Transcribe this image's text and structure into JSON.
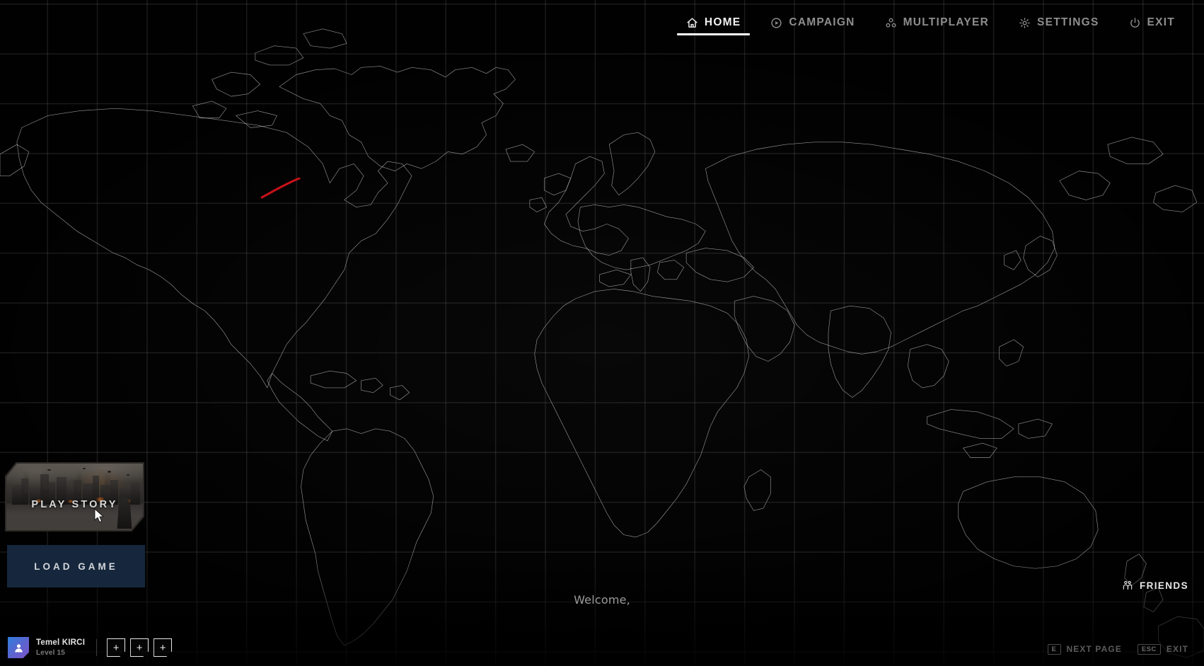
{
  "nav": {
    "items": [
      {
        "label": "HOME",
        "icon": "home-icon",
        "active": true
      },
      {
        "label": "CAMPAIGN",
        "icon": "play-circle-icon",
        "active": false
      },
      {
        "label": "MULTIPLAYER",
        "icon": "multiplayer-icon",
        "active": false
      },
      {
        "label": "SETTINGS",
        "icon": "gear-icon",
        "active": false
      },
      {
        "label": "EXIT",
        "icon": "power-icon",
        "active": false
      }
    ]
  },
  "left_panel": {
    "story_card": {
      "label": "PLAY STORY",
      "art": "destroyed-city"
    },
    "load_game": {
      "label": "LOAD GAME",
      "color": "#16273d"
    }
  },
  "profile": {
    "name": "Temel KIRCI",
    "level": "Level 15",
    "avatar_icon": "user-avatar-icon",
    "slots": [
      {
        "label": "+"
      },
      {
        "label": "+"
      },
      {
        "label": "+"
      }
    ]
  },
  "bottom": {
    "welcome": "Welcome,",
    "friends": {
      "label": "FRIENDS",
      "icon": "friends-icon"
    },
    "hints": [
      {
        "key": "E",
        "label": "NEXT PAGE"
      },
      {
        "key": "ESC",
        "label": "EXIT"
      }
    ]
  },
  "map": {
    "grid_color": "#969696",
    "land_stroke": "#c9c9c9",
    "trajectory_color": "#c9111a"
  }
}
